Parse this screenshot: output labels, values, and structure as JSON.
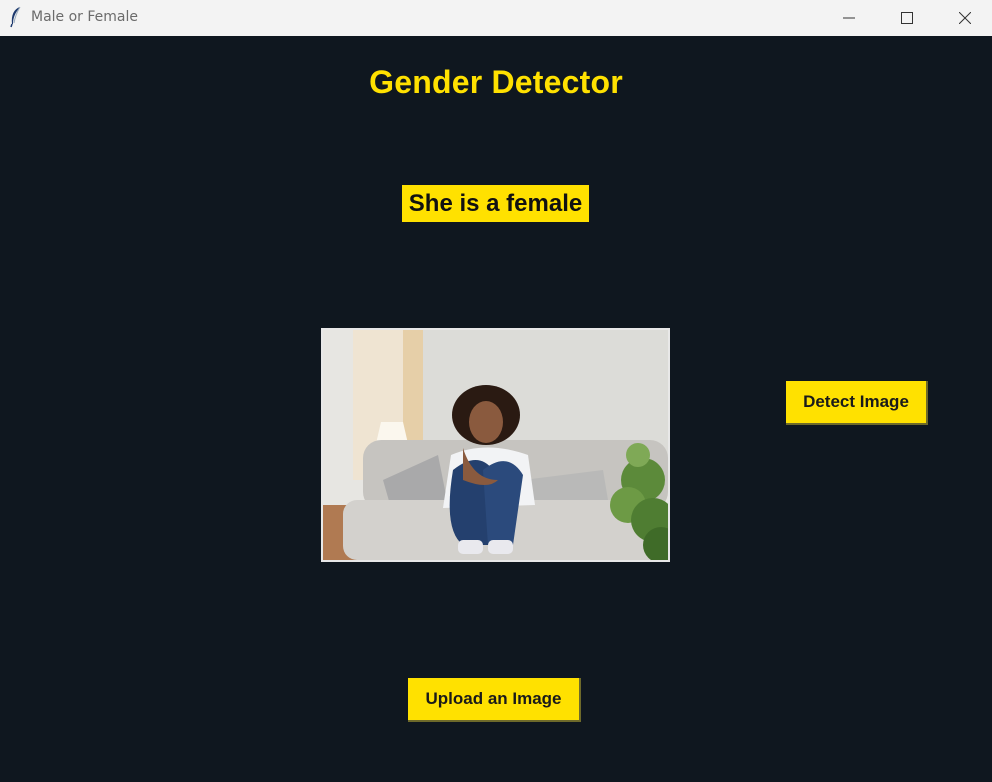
{
  "window": {
    "title": "Male or Female",
    "icons": {
      "app": "feather-icon",
      "minimize": "minimize-icon",
      "maximize": "maximize-icon",
      "close": "close-icon"
    }
  },
  "main": {
    "heading": "Gender Detector",
    "result_label": "She is a female",
    "image_alt": "woman sitting on a couch hugging her knees",
    "detect_button": "Detect Image",
    "upload_button": "Upload an Image"
  },
  "colors": {
    "background": "#0f171f",
    "accent": "#ffe100",
    "titlebar": "#f3f3f3"
  }
}
